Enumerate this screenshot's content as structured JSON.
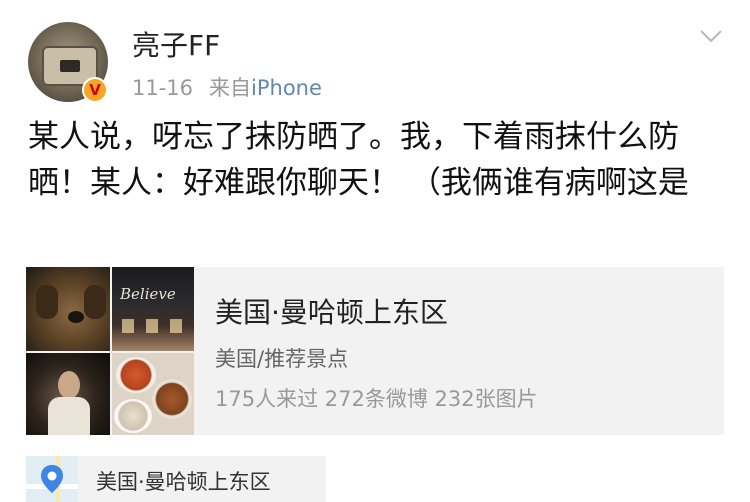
{
  "post": {
    "username": "亮子FF",
    "time": "11-16",
    "source_prefix": "来自",
    "source_device": "iPhone",
    "verified_badge": "V",
    "text": "某人说，呀忘了抹防晒了。我，下着雨抹什么防晒！某人：好难跟你聊天！ （我俩谁有病啊这是"
  },
  "location_card": {
    "title": "美国·曼哈顿上东区",
    "subtitle": "美国/推荐景点",
    "stats": "175人来过 272条微博 232张图片",
    "thumb_sign_text": "Believe"
  },
  "location_tag": {
    "label": "美国·曼哈顿上东区"
  },
  "icons": [
    "avatar",
    "verified-badge-icon",
    "chevron-down-icon",
    "location-pin-icon"
  ],
  "colors": {
    "link_blue": "#5d87b5",
    "badge_orange": "#f5a623",
    "badge_red": "#d0021b",
    "pin_blue": "#3d86e6",
    "card_bg": "#f2f2f2"
  }
}
